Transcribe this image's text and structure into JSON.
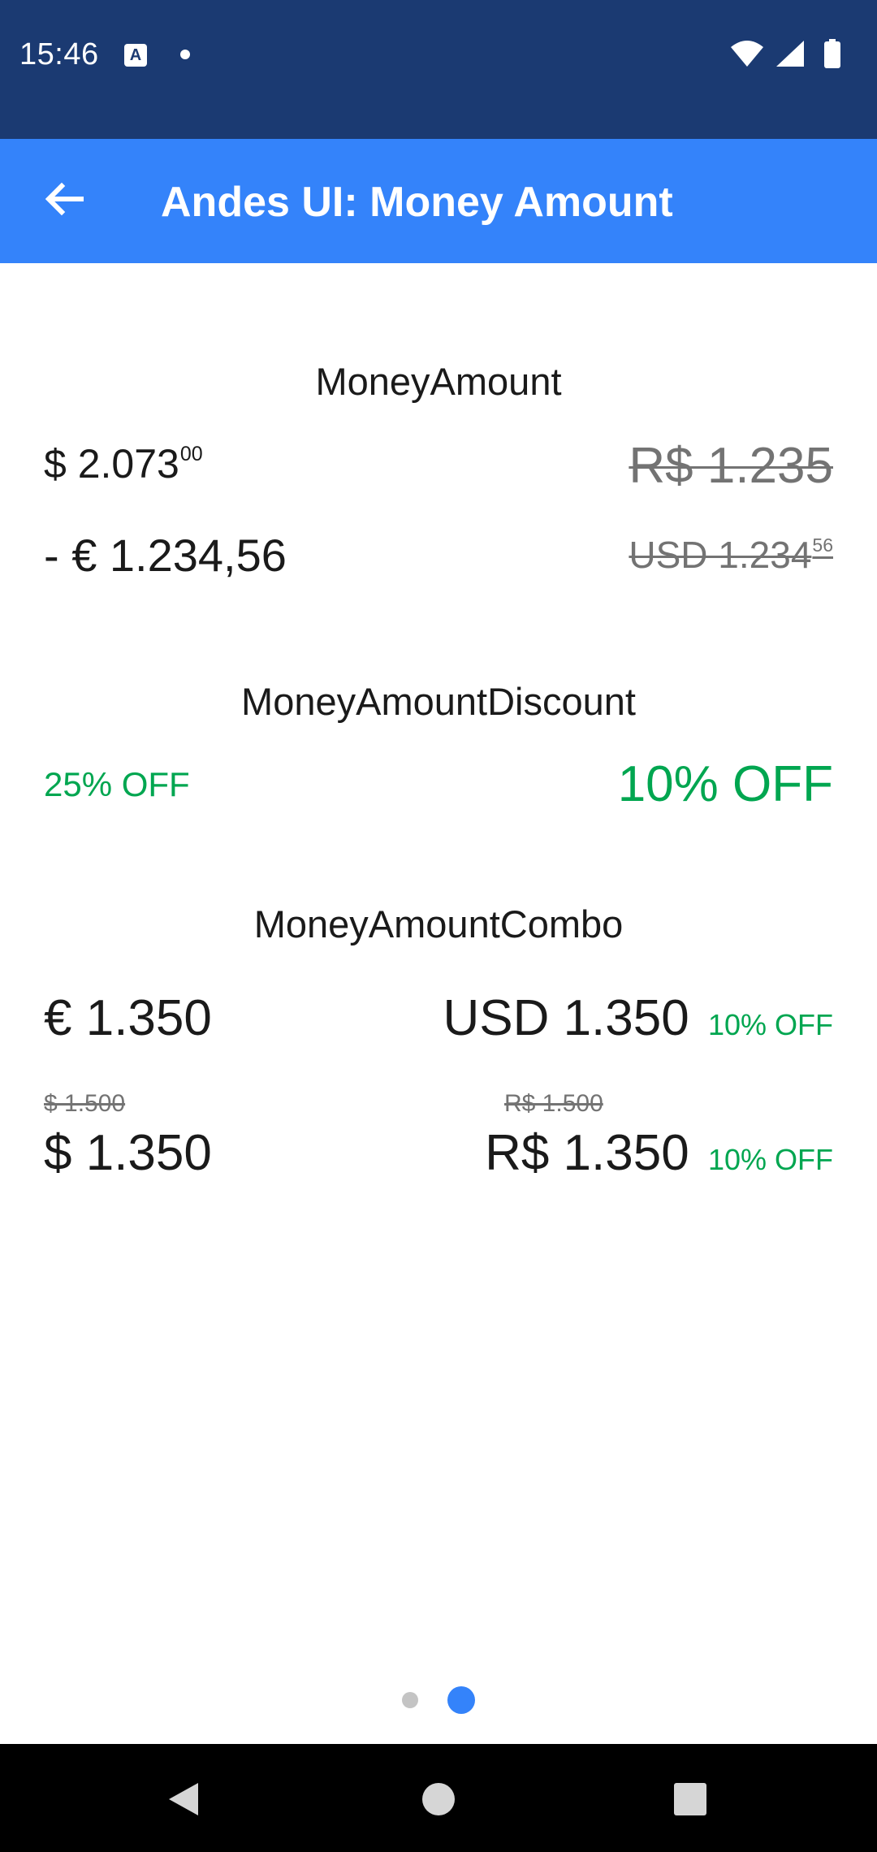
{
  "status": {
    "time": "15:46",
    "app_icon": "A"
  },
  "app_bar": {
    "title": "Andes UI: Money Amount",
    "back_icon": "arrow-back-icon"
  },
  "sections": {
    "money_amount": {
      "title": "MoneyAmount",
      "row1_left": {
        "main": "$ 2.073",
        "cents": "00"
      },
      "row1_right": {
        "main": "R$ 1.235"
      },
      "row2_left": {
        "main": "- € 1.234,56"
      },
      "row2_right": {
        "main": "USD 1.234",
        "cents": "56"
      }
    },
    "discount": {
      "title": "MoneyAmountDiscount",
      "left": "25% OFF",
      "right": "10% OFF"
    },
    "combo": {
      "title": "MoneyAmountCombo",
      "row1_left": "€ 1.350",
      "row1_right": {
        "amount": "USD 1.350",
        "discount": "10% OFF"
      },
      "row2_left": {
        "previous": "$ 1.500",
        "amount": "$ 1.350"
      },
      "row2_right": {
        "previous": "R$ 1.500",
        "amount": "R$ 1.350",
        "discount": "10% OFF"
      }
    }
  },
  "pager": {
    "total": 2,
    "active": 2
  },
  "colors": {
    "status_bar": "#1b3a72",
    "app_bar": "#3483fa",
    "discount_green": "#00a650",
    "strike_gray": "#737373"
  }
}
